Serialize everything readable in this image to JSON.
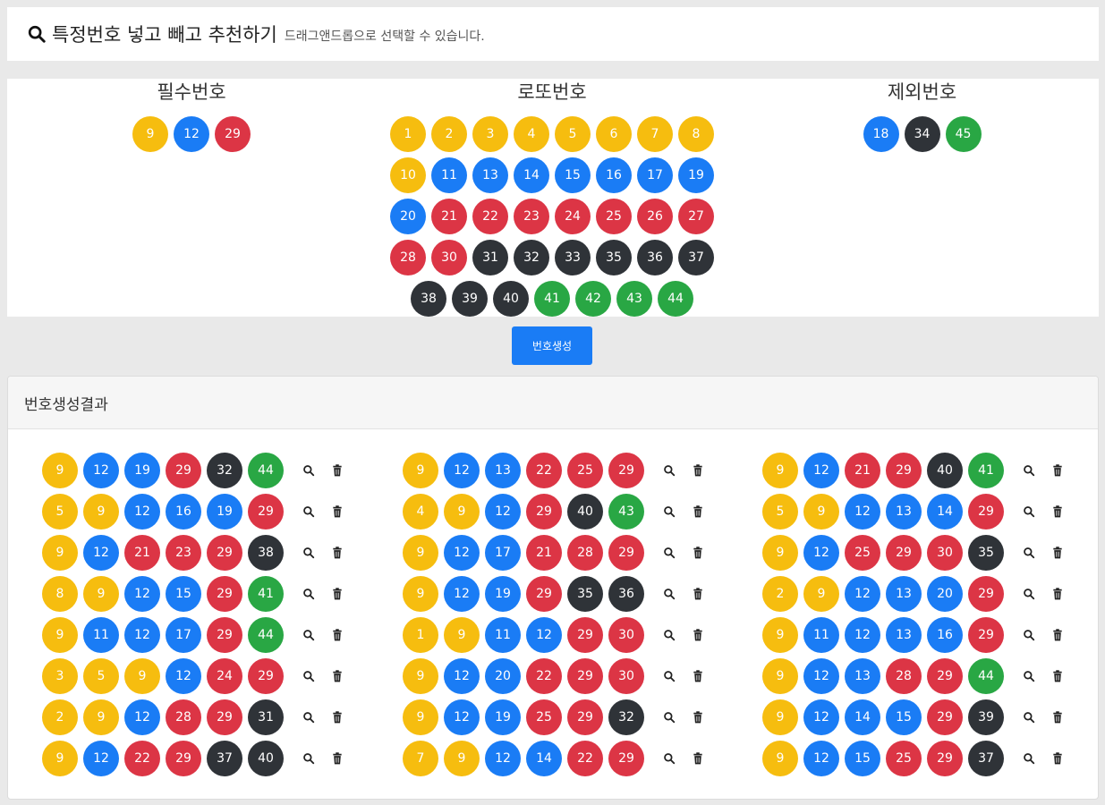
{
  "header": {
    "icon": "search-icon",
    "title": "특정번호 넣고 빼고 추천하기",
    "hint": "드래그앤드롭으로 선택할 수 있습니다."
  },
  "colors": {
    "yellow": "#f6bd0f",
    "blue": "#1a7cf5",
    "red": "#dc3545",
    "dark": "#2f3338",
    "green": "#29a744"
  },
  "required": {
    "title": "필수번호",
    "numbers": [
      9,
      12,
      29
    ]
  },
  "lotto": {
    "title": "로또번호",
    "numbers": [
      1,
      2,
      3,
      4,
      5,
      6,
      7,
      8,
      10,
      11,
      13,
      14,
      15,
      16,
      17,
      19,
      20,
      21,
      22,
      23,
      24,
      25,
      26,
      27,
      28,
      30,
      31,
      32,
      33,
      35,
      36,
      37,
      38,
      39,
      40,
      41,
      42,
      43,
      44
    ]
  },
  "excluded": {
    "title": "제외번호",
    "numbers": [
      18,
      34,
      45
    ]
  },
  "generate_button": {
    "label": "번호생성"
  },
  "results": {
    "title": "번호생성결과",
    "row_icons": [
      "search-icon",
      "trash-icon"
    ],
    "columns": [
      [
        [
          9,
          12,
          19,
          29,
          32,
          44
        ],
        [
          5,
          9,
          12,
          16,
          19,
          29
        ],
        [
          9,
          12,
          21,
          23,
          29,
          38
        ],
        [
          8,
          9,
          12,
          15,
          29,
          41
        ],
        [
          9,
          11,
          12,
          17,
          29,
          44
        ],
        [
          3,
          5,
          9,
          12,
          24,
          29
        ],
        [
          2,
          9,
          12,
          28,
          29,
          31
        ],
        [
          9,
          12,
          22,
          29,
          37,
          40
        ]
      ],
      [
        [
          9,
          12,
          13,
          22,
          25,
          29
        ],
        [
          4,
          9,
          12,
          29,
          40,
          43
        ],
        [
          9,
          12,
          17,
          21,
          28,
          29
        ],
        [
          9,
          12,
          19,
          29,
          35,
          36
        ],
        [
          1,
          9,
          11,
          12,
          29,
          30
        ],
        [
          9,
          12,
          20,
          22,
          29,
          30
        ],
        [
          9,
          12,
          19,
          25,
          29,
          32
        ],
        [
          7,
          9,
          12,
          14,
          22,
          29
        ]
      ],
      [
        [
          9,
          12,
          21,
          29,
          40,
          41
        ],
        [
          5,
          9,
          12,
          13,
          14,
          29
        ],
        [
          9,
          12,
          25,
          29,
          30,
          35
        ],
        [
          2,
          9,
          12,
          13,
          20,
          29
        ],
        [
          9,
          11,
          12,
          13,
          16,
          29
        ],
        [
          9,
          12,
          13,
          28,
          29,
          44
        ],
        [
          9,
          12,
          14,
          15,
          29,
          39
        ],
        [
          9,
          12,
          15,
          25,
          29,
          37
        ]
      ]
    ]
  }
}
